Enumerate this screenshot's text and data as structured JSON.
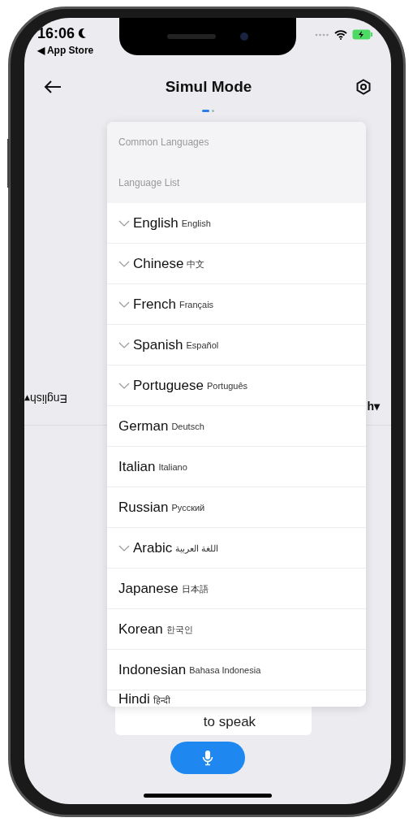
{
  "status_bar": {
    "time": "16:06",
    "back_link": "◀ App Store"
  },
  "nav": {
    "title": "Simul Mode"
  },
  "pages": [
    {
      "selected": true
    },
    {
      "selected": false
    }
  ],
  "left_language": {
    "label": "English▾"
  },
  "right_language": {
    "label": "h▾"
  },
  "prompt": {
    "text": "to speak"
  },
  "dropdown": {
    "sections": [
      "Common Languages",
      "Language List"
    ],
    "languages": [
      {
        "name": "English",
        "native": "English",
        "expandable": true
      },
      {
        "name": "Chinese",
        "native": "中文",
        "expandable": true
      },
      {
        "name": "French",
        "native": "Français",
        "expandable": true
      },
      {
        "name": "Spanish",
        "native": "Español",
        "expandable": true
      },
      {
        "name": "Portuguese",
        "native": "Português",
        "expandable": true
      },
      {
        "name": "German",
        "native": "Deutsch",
        "expandable": false
      },
      {
        "name": "Italian",
        "native": "Italiano",
        "expandable": false
      },
      {
        "name": "Russian",
        "native": "Русский",
        "expandable": false
      },
      {
        "name": "Arabic",
        "native": "اللغة العربية",
        "expandable": true
      },
      {
        "name": "Japanese",
        "native": "日本語",
        "expandable": false
      },
      {
        "name": "Korean",
        "native": "한국인",
        "expandable": false
      },
      {
        "name": "Indonesian",
        "native": "Bahasa Indonesia",
        "expandable": false
      },
      {
        "name": "Hindi",
        "native": "हिन्दी",
        "expandable": false
      }
    ]
  }
}
